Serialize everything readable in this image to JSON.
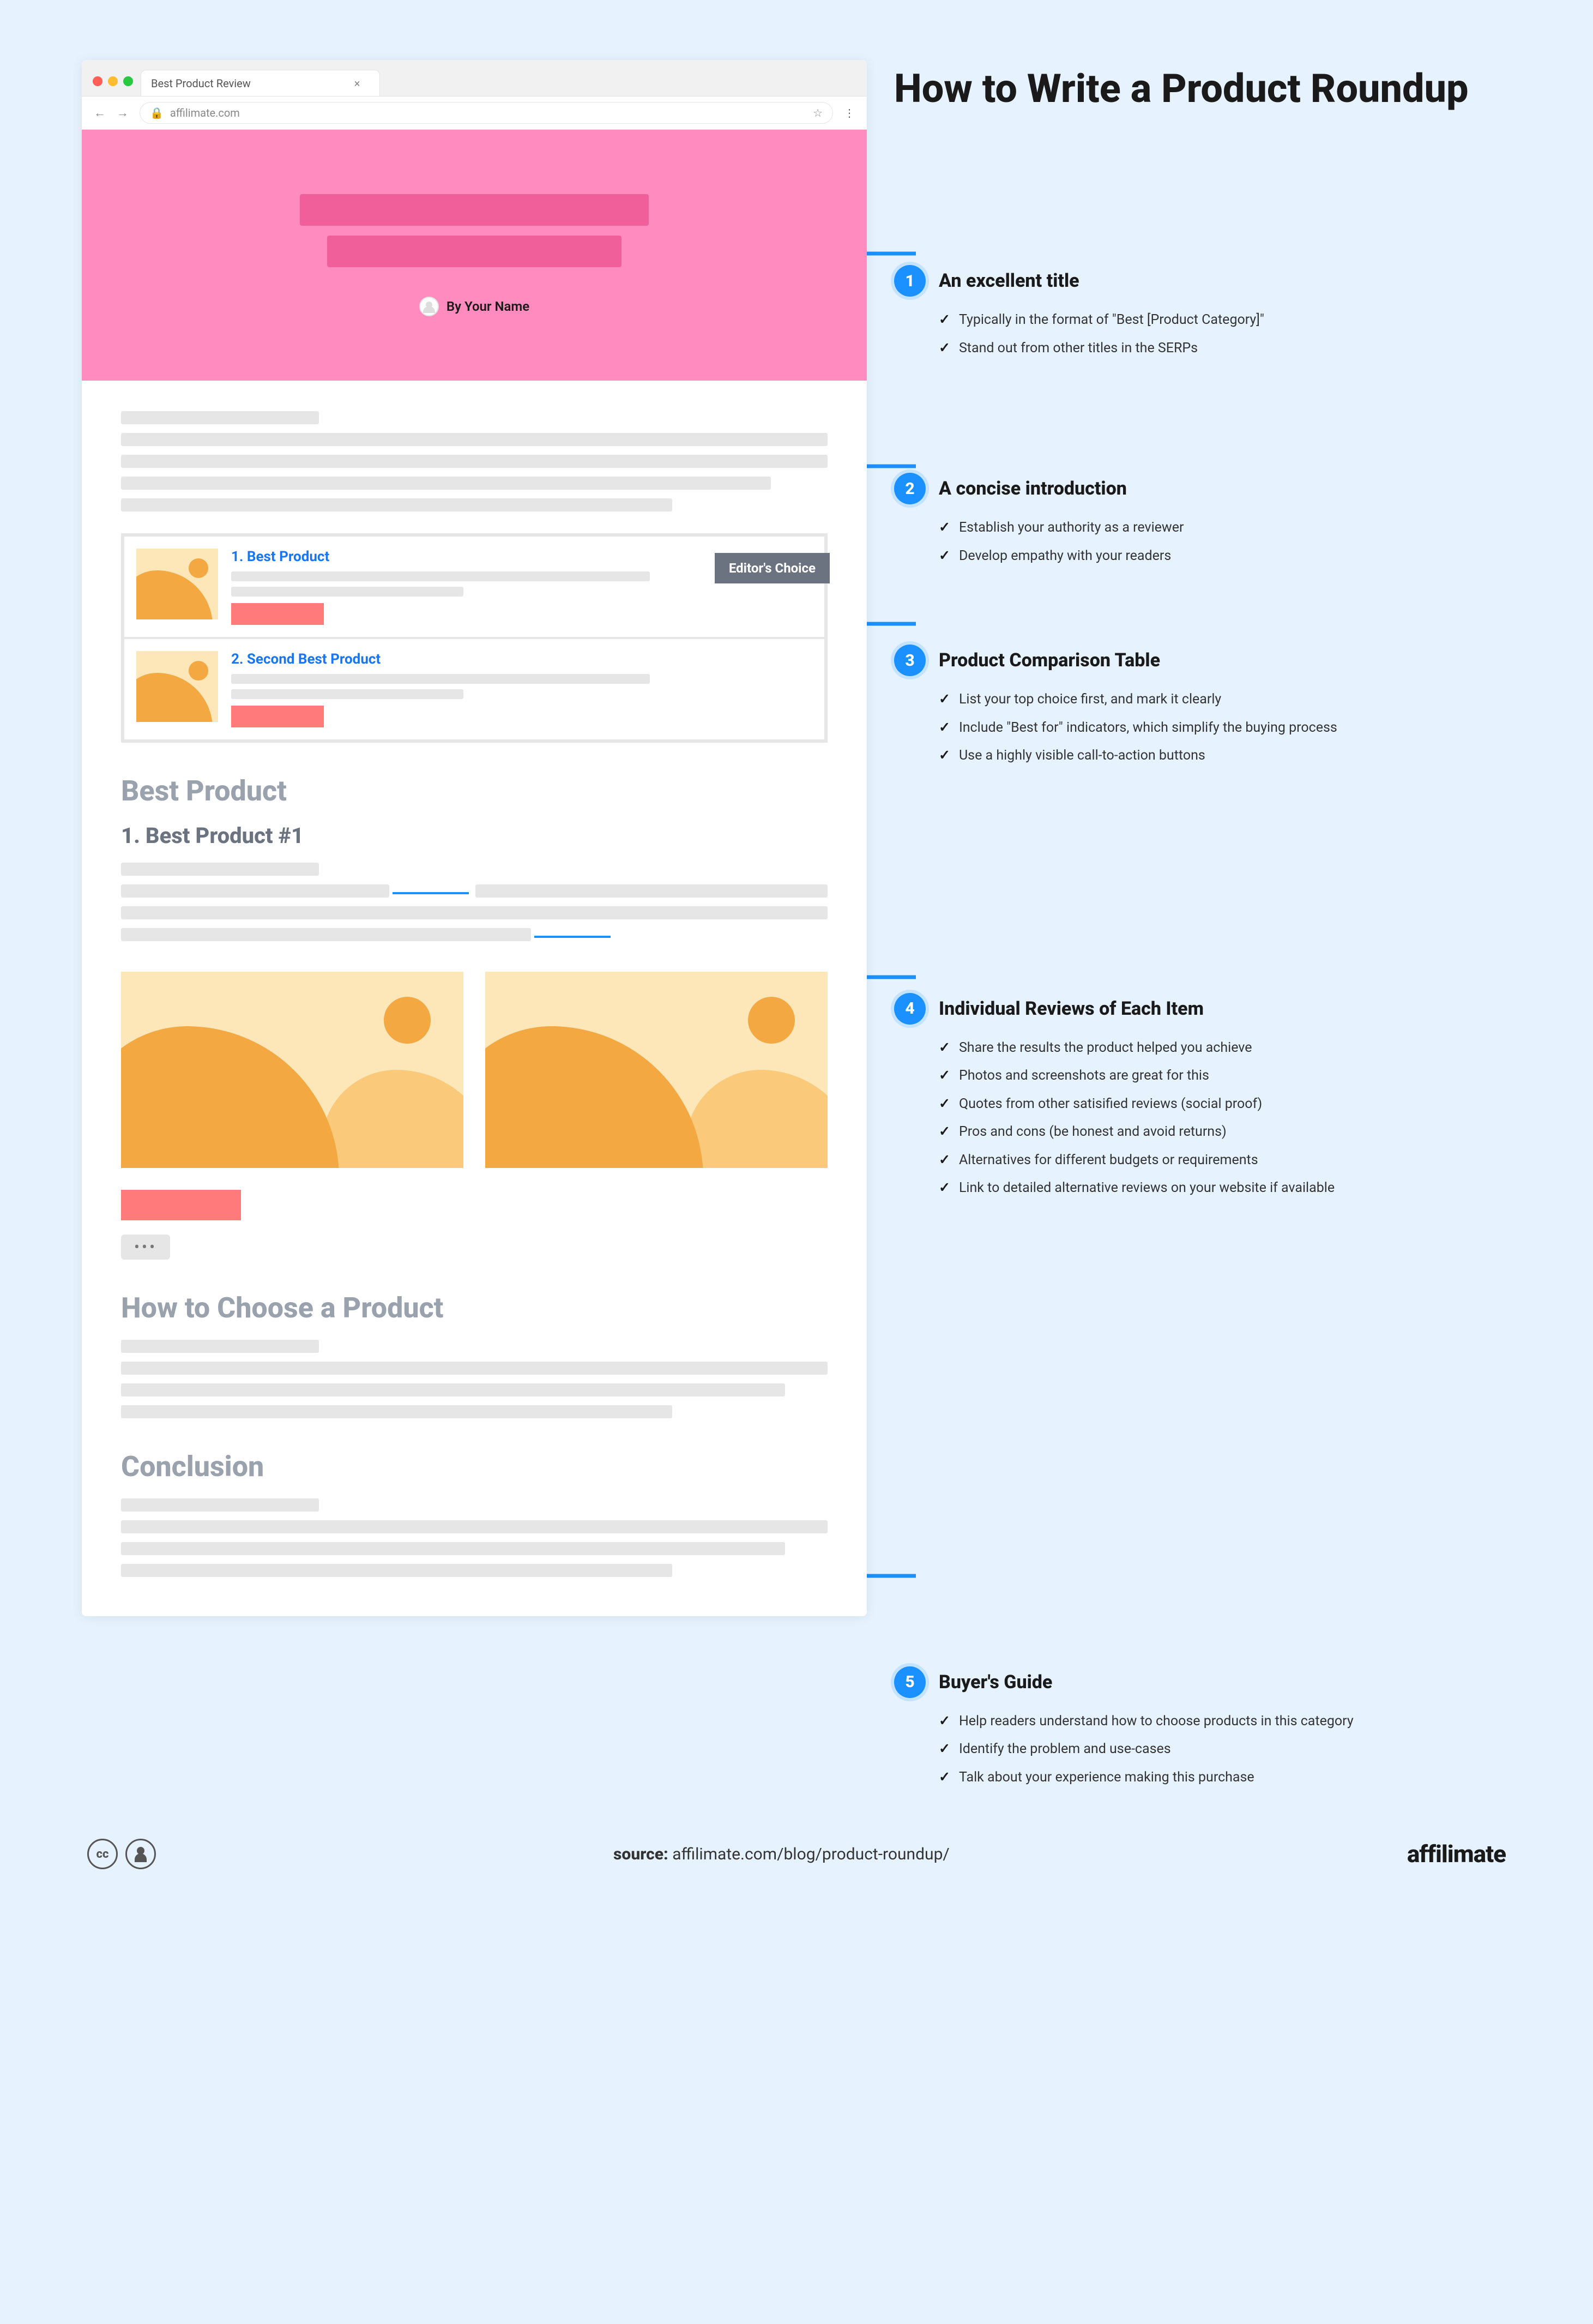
{
  "title": "How to Write a Product Roundup",
  "browser": {
    "tab_title": "Best Product Review",
    "url": "affilimate.com",
    "lock_icon": "lock-icon",
    "star_icon": "star-icon",
    "menu_icon": "menu-icon"
  },
  "hero": {
    "byline": "By Your Name"
  },
  "comparison": {
    "badge": "Editor's Choice",
    "rows": [
      {
        "label": "1. Best Product"
      },
      {
        "label": "2. Second Best Product"
      }
    ]
  },
  "sections": {
    "best_product_heading": "Best Product",
    "item_heading": "1.  Best Product #1",
    "guide_heading": "How to Choose a Product",
    "conclusion_heading": "Conclusion"
  },
  "callouts": [
    {
      "n": "1",
      "title": "An excellent title",
      "items": [
        "Typically in the format of \"Best [Product Category]\"",
        "Stand out from other titles in the SERPs"
      ]
    },
    {
      "n": "2",
      "title": "A concise introduction",
      "items": [
        "Establish your authority as a reviewer",
        "Develop empathy with your readers"
      ]
    },
    {
      "n": "3",
      "title": "Product Comparison Table",
      "items": [
        "List your top choice first, and mark it clearly",
        "Include \"Best for\" indicators, which simplify the buying process",
        "Use a highly visible call-to-action buttons"
      ]
    },
    {
      "n": "4",
      "title": "Individual Reviews of Each Item",
      "items": [
        "Share the results the product helped you achieve",
        "Photos and screenshots are great for this",
        "Quotes from other satisified reviews (social proof)",
        "Pros and cons (be honest and avoid returns)",
        "Alternatives for different budgets or requirements",
        "Link to detailed alternative reviews on your website if available"
      ]
    },
    {
      "n": "5",
      "title": "Buyer's Guide",
      "items": [
        "Help readers understand how to choose products in this category",
        "Identify the problem and use-cases",
        "Talk about your experience making this purchase"
      ]
    }
  ],
  "footer": {
    "source_label": "source:",
    "source_url": "affilimate.com/blog/product-roundup/",
    "brand": "affilimate"
  }
}
